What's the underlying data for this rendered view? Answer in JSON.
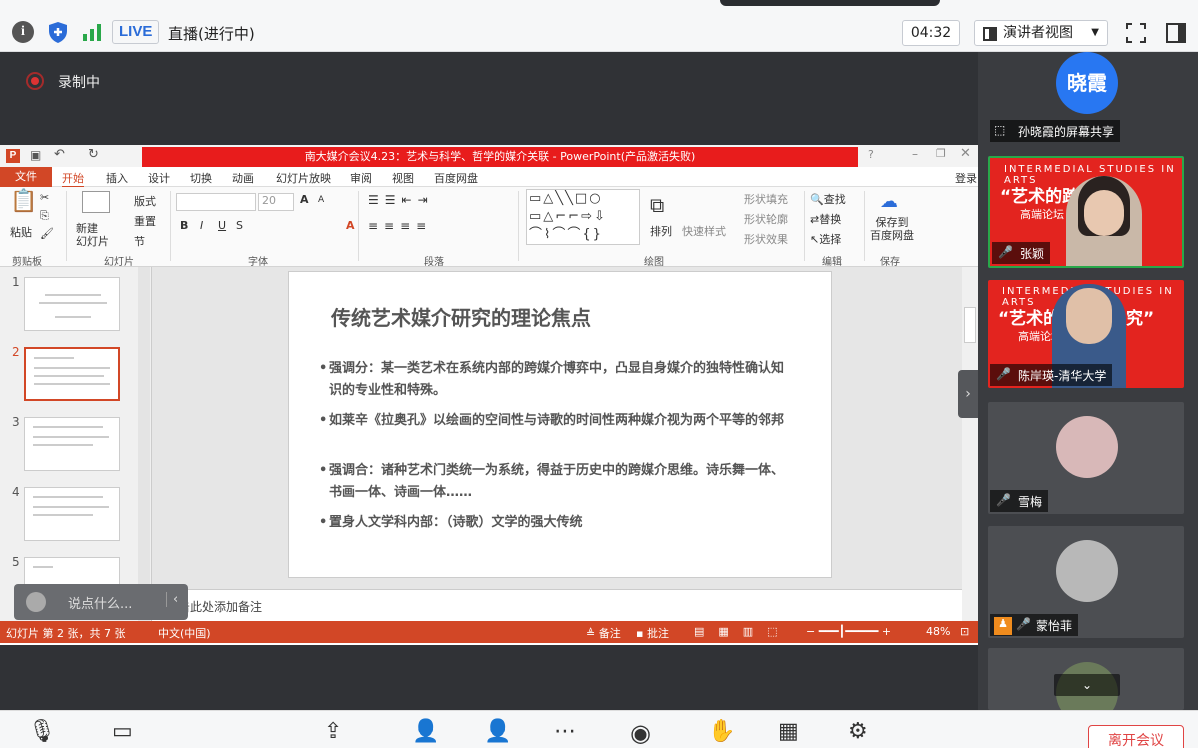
{
  "topbar": {
    "live_label": "LIVE",
    "live_status": "直播(进行中)",
    "timer": "04:32",
    "view_mode": "演讲者视图"
  },
  "recording": {
    "label": "录制中"
  },
  "ppt": {
    "window_title": "南大媒介会议4.23：艺术与科学、哲学的媒介关联 - PowerPoint(产品激活失败)",
    "menu": [
      "文件",
      "开始",
      "插入",
      "设计",
      "切换",
      "动画",
      "幻灯片放映",
      "审阅",
      "视图",
      "百度网盘"
    ],
    "login": "登录",
    "ribbon": {
      "paste": "粘贴",
      "new_slide": "新建\n幻灯片",
      "layout": "版式",
      "reset": "重置",
      "section": "节",
      "font_size": "20",
      "arrange": "排列",
      "quick_style": "快速样式",
      "shape_fill": "形状填充",
      "shape_outline": "形状轮廓",
      "shape_effect": "形状效果",
      "find": "查找",
      "replace": "替换",
      "select": "选择",
      "save_baidu": "保存到\n百度网盘",
      "groups": [
        "剪贴板",
        "幻灯片",
        "字体",
        "段落",
        "绘图",
        "编辑",
        "保存"
      ]
    },
    "slide_numbers": [
      "1",
      "2",
      "3",
      "4",
      "5"
    ],
    "slide": {
      "title": "传统艺术媒介研究的理论焦点",
      "bullets": [
        "强调分：某一类艺术在系统内部的跨媒介博弈中，凸显自身媒介的独特性确认知识的专业性和特殊。",
        "如莱辛《拉奥孔》以绘画的空间性与诗歌的时间性两种媒介视为两个平等的邻邦",
        "强调合：诸种艺术门类统一为系统，得益于历史中的跨媒介思维。诗乐舞一体、书画一体、诗画一体……",
        "置身人文学科内部：（诗歌）文学的强大传统"
      ]
    },
    "notes_placeholder": "单击此处添加备注",
    "status": {
      "slide_info": "幻灯片 第 2 张，共 7 张",
      "language": "中文(中国)",
      "notes": "备注",
      "comments": "批注",
      "zoom": "48%"
    }
  },
  "chat": {
    "placeholder": "说点什么..."
  },
  "participants": [
    {
      "name": "孙晓霞的屏幕共享",
      "avatar_text": "晓霞"
    },
    {
      "name": "张颖",
      "banner_en": "INTERMEDIAL STUDIES IN ARTS",
      "banner_cn": "“艺术的跨",
      "banner_sub": "高端论坛"
    },
    {
      "name": "陈岸瑛-清华大学",
      "banner_en": "INTERMEDIAL STUDIES IN ARTS",
      "banner_cn": "“艺术的跨",
      "banner_quote_end": "究”",
      "banner_sub": "高端论坛"
    },
    {
      "name": "雪梅"
    },
    {
      "name": "蒙怡菲"
    },
    {
      "name": ""
    }
  ],
  "bottom": {
    "leave_label": "离开会议"
  }
}
